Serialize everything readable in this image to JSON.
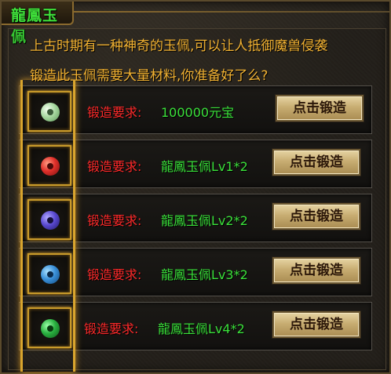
{
  "window": {
    "title": "龍鳳玉佩",
    "title_color": "#3fe03a"
  },
  "intro": {
    "line1": "上古时期有一种神奇的玉佩,可以让人抵御魔兽侵袭",
    "line2": "锻造此玉佩需要大量材料,你准备好了么?"
  },
  "colors": {
    "intro_text": "#f2b232",
    "requirement_label": "#ff2a2a",
    "requirement_value": "#3ae03a",
    "slot_border": "#c89a2a"
  },
  "rows": [
    {
      "icon": "jade-disc-icon",
      "gem_color": "#a8d8a0",
      "label": "锻造要求:",
      "value": "100000元宝",
      "button": "点击锻造"
    },
    {
      "icon": "red-jade-pendant-icon",
      "gem_color": "#e0302a",
      "label": "锻造要求:",
      "value": "龍鳳玉佩Lv1*2",
      "button": "点击锻造"
    },
    {
      "icon": "purple-jade-pendant-icon",
      "gem_color": "#5a4ad0",
      "label": "锻造要求:",
      "value": "龍鳳玉佩Lv2*2",
      "button": "点击锻造"
    },
    {
      "icon": "blue-jade-pendant-icon",
      "gem_color": "#3a90d8",
      "label": "锻造要求:",
      "value": "龍鳳玉佩Lv3*2",
      "button": "点击锻造"
    },
    {
      "icon": "green-jade-pendant-icon",
      "gem_color": "#2ab040",
      "label": "锻造要求:",
      "value": "龍鳳玉佩Lv4*2",
      "button": "点击锻造"
    }
  ]
}
